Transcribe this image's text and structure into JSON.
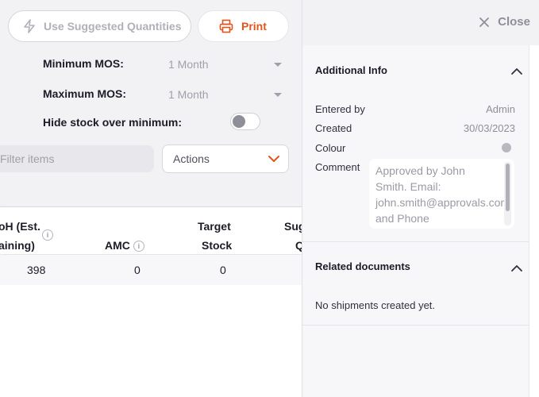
{
  "toolbar": {
    "suggest_label": "Use Suggested Quantities",
    "print_label": "Print"
  },
  "filters": {
    "min_mos_label": "Minimum MOS:",
    "min_mos_value": "1 Month",
    "max_mos_label": "Maximum MOS:",
    "max_mos_value": "1 Month",
    "hide_stock_label": "Hide stock over minimum:",
    "hide_stock_on": false,
    "filter_placeholder": "Filter items",
    "actions_label": "Actions"
  },
  "table": {
    "headers": {
      "soh_line1": "oH (Est.",
      "soh_line2": "aining)",
      "amc": "AMC",
      "target_line1": "Target",
      "target_line2": "Stock",
      "suggested_line1": "Sug",
      "suggested_line2": "Q"
    },
    "rows": [
      {
        "soh": "398",
        "amc": "0",
        "target": "0"
      }
    ]
  },
  "panel": {
    "close_label": "Close",
    "additional_info": {
      "title": "Additional Info",
      "entered_by_label": "Entered by",
      "entered_by_value": "Admin",
      "created_label": "Created",
      "created_value": "30/03/2023",
      "colour_label": "Colour",
      "colour_value": "#b8b8c0",
      "comment_label": "Comment",
      "comment_value": "Approved by John Smith. Email: john.smith@approvals.com and Phone"
    },
    "related_documents": {
      "title": "Related documents",
      "empty_text": "No shipments created yet."
    }
  },
  "colors": {
    "accent": "#e2541e",
    "panel_bg": "#f2f2f5"
  }
}
